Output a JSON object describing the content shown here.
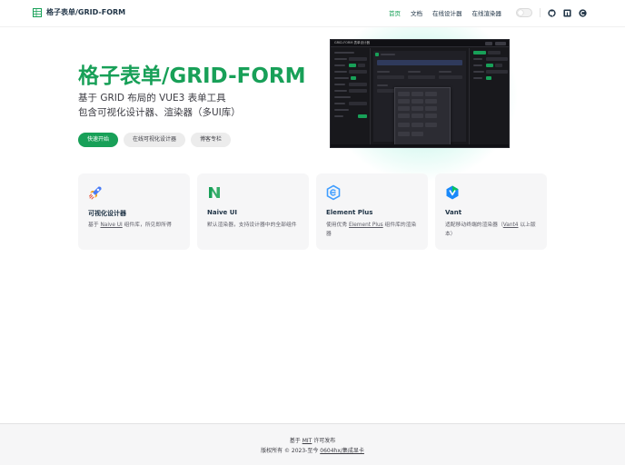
{
  "header": {
    "brand_title": "格子表单/GRID-FORM",
    "nav": [
      {
        "label": "首页",
        "active": true
      },
      {
        "label": "文档",
        "active": false
      },
      {
        "label": "在线设计器",
        "active": false
      },
      {
        "label": "在线渲染器",
        "active": false
      }
    ],
    "social_icons": [
      "github-icon",
      "gitee-icon",
      "csdn-icon"
    ]
  },
  "hero": {
    "title": "格子表单/GRID-FORM",
    "tagline_1": "基于 GRID 布局的 VUE3 表单工具",
    "tagline_2": "包含可视化设计器、渲染器（多UI库）",
    "actions": {
      "primary": "快速开始",
      "designer": "在线可视化设计器",
      "blog": "博客专栏"
    },
    "preview_title": "GRID-FORM 表单设计器"
  },
  "features": [
    {
      "icon": "rocket-icon",
      "title": "可视化设计器",
      "pre": "基于 ",
      "link": "Naive UI",
      "post": " 组件库，所见即所得"
    },
    {
      "icon": "naive-ui-logo-icon",
      "title": "Naive UI",
      "pre": "默认渲染器，支持设计器中的全部组件",
      "link": "",
      "post": ""
    },
    {
      "icon": "element-plus-logo-icon",
      "title": "Element Plus",
      "pre": "使用优秀 ",
      "link": "Element Plus",
      "post": " 组件库的渲染器"
    },
    {
      "icon": "vant-logo-icon",
      "title": "Vant",
      "pre": "适配移动终端的渲染器（",
      "link": "Vant4",
      "post": " 以上版本）"
    }
  ],
  "footer": {
    "line1_pre": "基于 ",
    "line1_link": "MIT",
    "line1_post": " 许可发布",
    "line2_pre": "版权所有 © 2023-至今 ",
    "line2_link": "0604hx/集成显卡"
  },
  "colors": {
    "brand": "#18a058",
    "text": "#213547",
    "card_bg": "#f6f6f7"
  }
}
